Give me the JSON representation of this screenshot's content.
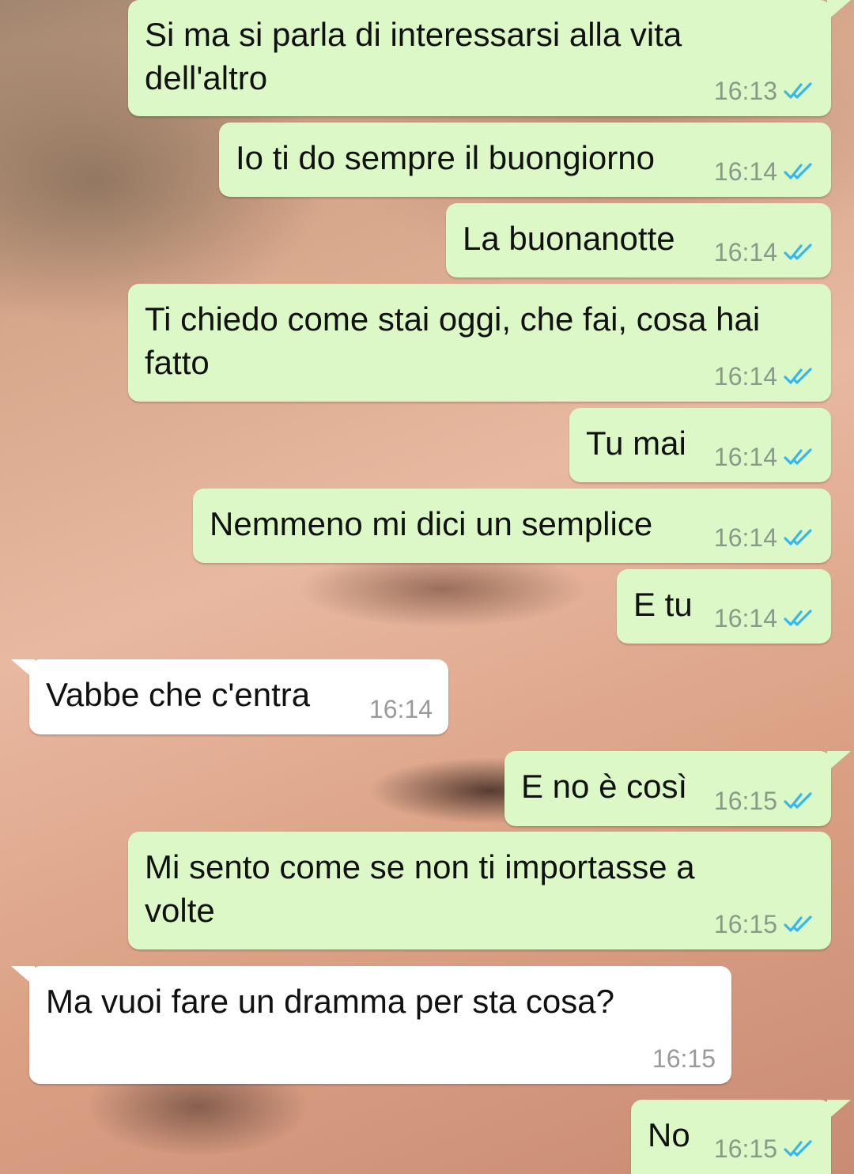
{
  "theme": {
    "outgoing_bubble": "#dcf8c6",
    "incoming_bubble": "#ffffff",
    "read_tick_color": "#34b7f1"
  },
  "messages": [
    {
      "direction": "outgoing",
      "text": "Si ma si parla di interessarsi alla vita\ndell'altro",
      "time": "16:13",
      "status_icon": "double-check-read-icon"
    },
    {
      "direction": "outgoing",
      "text": "Io ti do sempre il buongiorno",
      "time": "16:14",
      "status_icon": "double-check-read-icon"
    },
    {
      "direction": "outgoing",
      "text": "La buonanotte",
      "time": "16:14",
      "status_icon": "double-check-read-icon"
    },
    {
      "direction": "outgoing",
      "text": "Ti chiedo come stai oggi, che fai, cosa hai\nfatto",
      "time": "16:14",
      "status_icon": "double-check-read-icon"
    },
    {
      "direction": "outgoing",
      "text": "Tu mai",
      "time": "16:14",
      "status_icon": "double-check-read-icon"
    },
    {
      "direction": "outgoing",
      "text": "Nemmeno mi dici un semplice",
      "time": "16:14",
      "status_icon": "double-check-read-icon"
    },
    {
      "direction": "outgoing",
      "text": "E tu",
      "time": "16:14",
      "status_icon": "double-check-read-icon"
    },
    {
      "direction": "incoming",
      "text": "Vabbe che c'entra",
      "time": "16:14"
    },
    {
      "direction": "outgoing",
      "text": "E no è così",
      "time": "16:15",
      "status_icon": "double-check-read-icon"
    },
    {
      "direction": "outgoing",
      "text": "Mi sento come se non ti importasse a\nvolte",
      "time": "16:15",
      "status_icon": "double-check-read-icon"
    },
    {
      "direction": "incoming",
      "text": "Ma vuoi fare un dramma per sta cosa?",
      "time": "16:15"
    },
    {
      "direction": "outgoing",
      "text": "No",
      "time": "16:15",
      "status_icon": "double-check-read-icon"
    }
  ]
}
